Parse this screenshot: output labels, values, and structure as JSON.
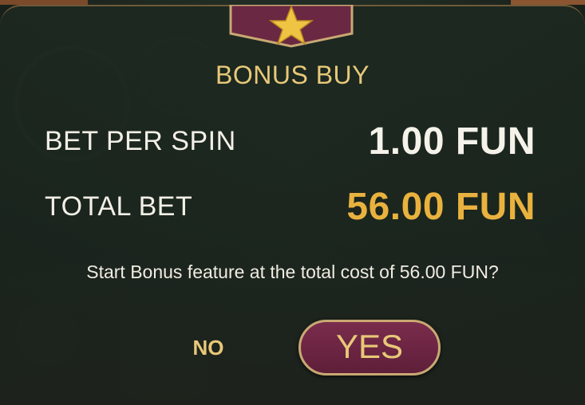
{
  "dialog": {
    "title": "BONUS BUY",
    "badge_icon": "star-icon",
    "bet_per_spin_label": "BET PER SPIN",
    "bet_per_spin_value": "1.00 FUN",
    "total_bet_label": "TOTAL BET",
    "total_bet_value": "56.00 FUN",
    "question": "Start Bonus feature at the total cost of 56.00 FUN?",
    "no_label": "NO",
    "yes_label": "YES"
  },
  "colors": {
    "gold": "#e8c878",
    "total_value": "#e9b23e",
    "yes_button": "#6d2644",
    "panel": "#1f2c23"
  }
}
